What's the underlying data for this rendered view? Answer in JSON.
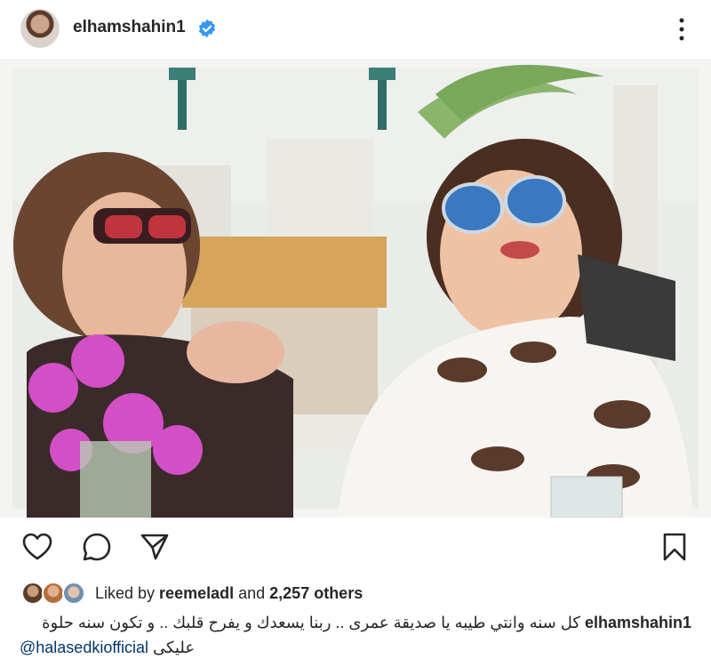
{
  "post": {
    "username": "elhamshahin1",
    "verified": true,
    "avatar_icon": "profile-avatar",
    "more_icon": "more-vertical-icon"
  },
  "actions": {
    "like_icon": "heart-icon",
    "comment_icon": "comment-icon",
    "share_icon": "send-icon",
    "save_icon": "bookmark-icon"
  },
  "likes": {
    "prefix": "Liked by ",
    "user": "reemeladl",
    "middle": " and ",
    "count": "2,257 others"
  },
  "caption": {
    "username": "elhamshahin1",
    "text": "كل سنه وانتي طيبه يا صديقة عمرى .. ربنا يسعدك و يفرح قلبك .. و تكون سنه حلوة",
    "mention": "@halasedkiofficial",
    "text_after": "عليكى"
  },
  "colors": {
    "verified_blue": "#3897f0",
    "mention_blue": "#00376b",
    "text": "#262626"
  }
}
